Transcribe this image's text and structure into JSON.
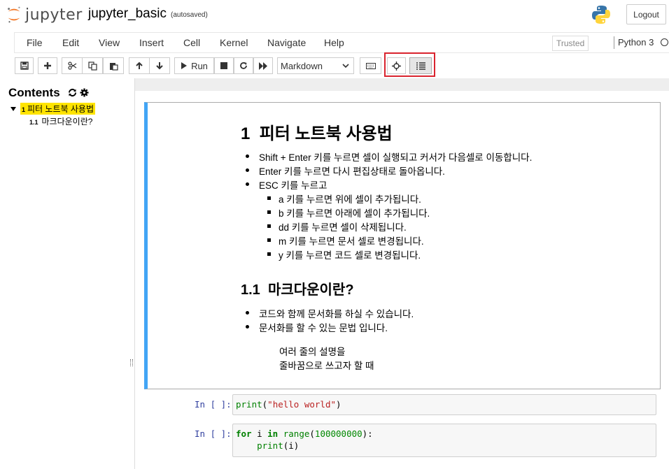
{
  "header": {
    "logo_text": "jupyter",
    "notebook_title": "jupyter_basic",
    "autosave_status": "(autosaved)",
    "logout_label": "Logout"
  },
  "menubar": {
    "items": [
      "File",
      "Edit",
      "View",
      "Insert",
      "Cell",
      "Kernel",
      "Navigate",
      "Help"
    ],
    "trusted_label": "Trusted",
    "kernel_name": "Python 3"
  },
  "toolbar": {
    "run_label": "Run",
    "cell_type": "Markdown",
    "icons": [
      "save-icon",
      "plus-icon",
      "scissors-icon",
      "copy-icon",
      "paste-icon",
      "arrow-up-icon",
      "arrow-down-icon",
      "play-icon",
      "stop-icon",
      "restart-icon",
      "fast-forward-icon",
      "keyboard-icon",
      "crosshair-icon",
      "list-icon"
    ],
    "highlight_color": "#d9232e"
  },
  "toc": {
    "title": "Contents",
    "items": [
      {
        "num": "1",
        "label": "피터 노트북 사용법"
      },
      {
        "num": "1.1",
        "label": "마크다운이란?"
      }
    ]
  },
  "markdown_cell": {
    "h1_num": "1",
    "h1_text": "피터 노트북 사용법",
    "list1": [
      "Shift + Enter 키를 누르면 셀이 실행되고 커서가 다음셀로 이동합니다.",
      "Enter 키를 누르면 다시 편집상태로 돌아옵니다.",
      "ESC 키를 누르고"
    ],
    "sublist": [
      "a 키를 누르면 위에 셀이 추가됩니다.",
      "b 키를 누르면 아래에 셀이 추가됩니다.",
      "dd 키를 누르면 셀이 삭제됩니다.",
      "m 키를 누르면 문서 셀로 변경됩니다.",
      "y 키를 누르면 코드 셀로 변경됩니다."
    ],
    "h2_num": "1.1",
    "h2_text": "마크다운이란?",
    "list2": [
      "코드와 함께 문서화를 하실 수 있습니다.",
      "문서화를 할 수 있는 문법 입니다."
    ],
    "pre_lines": [
      "여러 줄의 설명을",
      "줄바꿈으로 쓰고자 할 때"
    ],
    "accent_color": "#42a5f5"
  },
  "code_cells": [
    {
      "prompt": "In [ ]:",
      "lines": [
        "print(\"hello world\")"
      ]
    },
    {
      "prompt": "In [ ]:",
      "lines": [
        "for i in range(100000000):",
        "    print(i)"
      ]
    }
  ]
}
